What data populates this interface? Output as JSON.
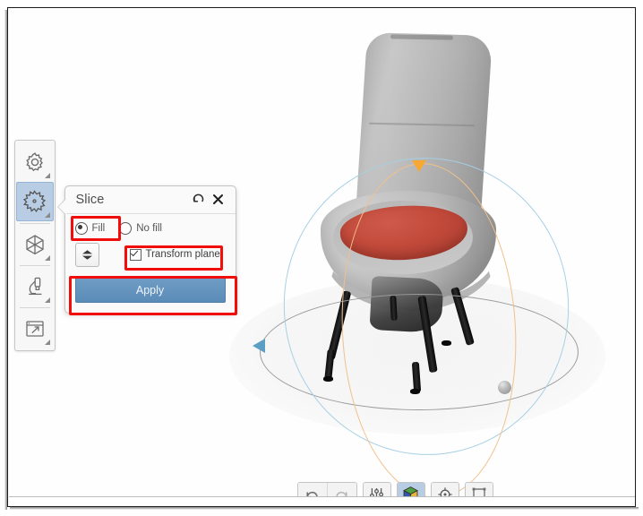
{
  "app": {
    "viewport_label": "3d-viewport",
    "model_name": "chair"
  },
  "left_toolbar": {
    "items": [
      {
        "id": "settings",
        "icon": "gear-icon",
        "label": "Settings",
        "active": false,
        "has_submenu": true
      },
      {
        "id": "slice",
        "icon": "sawblade-icon",
        "label": "Slice",
        "active": true,
        "has_submenu": true
      },
      {
        "id": "mesh",
        "icon": "hexagon-mesh-icon",
        "label": "Mesh",
        "active": false,
        "has_submenu": true
      },
      {
        "id": "inspect",
        "icon": "microscope-icon",
        "label": "Inspect",
        "active": false,
        "has_submenu": true
      },
      {
        "id": "export",
        "icon": "export-window-icon",
        "label": "Export",
        "active": false,
        "has_submenu": true
      }
    ]
  },
  "panel": {
    "title": "Slice",
    "reset_icon": "reset-arrow-icon",
    "close_icon": "close-icon",
    "fill_options": [
      {
        "id": "fill",
        "label": "Fill",
        "selected": true
      },
      {
        "id": "no-fill",
        "label": "No fill",
        "selected": false
      }
    ],
    "flip_button": {
      "icon": "flip-plane-icon",
      "label": ""
    },
    "transform_plane": {
      "label": "Transform plane",
      "checked": true
    },
    "apply_label": "Apply",
    "highlight_color": "#f20d0d",
    "apply_color": "#5b8cb8"
  },
  "bottom_toolbar": {
    "groups": [
      {
        "id": "history",
        "buttons": [
          {
            "id": "undo",
            "icon": "undo-icon",
            "active": false,
            "has_submenu": false
          },
          {
            "id": "redo",
            "icon": "redo-icon",
            "active": false,
            "has_submenu": false
          }
        ]
      },
      {
        "id": "adjust",
        "buttons": [
          {
            "id": "sliders",
            "icon": "sliders-icon",
            "active": false,
            "has_submenu": true
          }
        ]
      },
      {
        "id": "view-mode",
        "buttons": [
          {
            "id": "shaded",
            "icon": "colored-cube-icon",
            "active": true,
            "has_submenu": true
          }
        ]
      },
      {
        "id": "pivot",
        "buttons": [
          {
            "id": "target",
            "icon": "crosshair-target-icon",
            "active": false,
            "has_submenu": true
          }
        ]
      },
      {
        "id": "bounds",
        "buttons": [
          {
            "id": "bounding-box",
            "icon": "bounding-box-icon",
            "active": false,
            "has_submenu": true
          }
        ]
      }
    ]
  },
  "gizmo": {
    "handles": [
      {
        "id": "orange-cone",
        "color": "#f6a832",
        "shape": "triangle-down"
      },
      {
        "id": "blue-cone",
        "color": "#5d9ec4",
        "shape": "cone-left"
      },
      {
        "id": "gray-sphere",
        "color": "#b6b6b6",
        "shape": "sphere"
      }
    ],
    "rings": [
      {
        "id": "gray-ring",
        "color": "#9a9a9a"
      },
      {
        "id": "blue-ring",
        "color": "#a6cfe4"
      },
      {
        "id": "orange-ring",
        "color": "#f2c08a"
      }
    ]
  }
}
